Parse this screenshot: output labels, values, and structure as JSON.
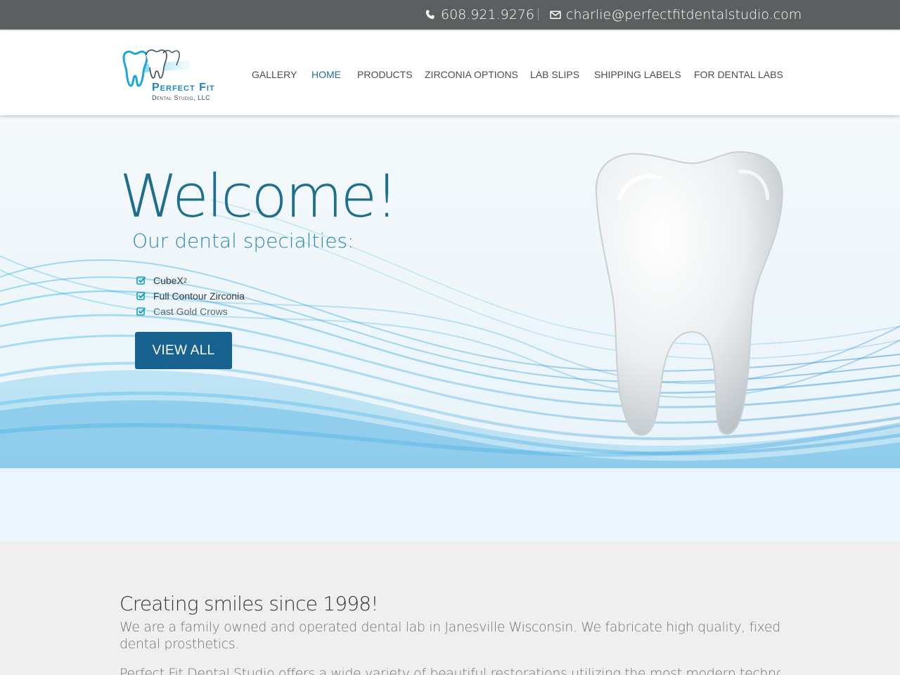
{
  "topbar": {
    "phone": "608.921.9276",
    "email": "charlie@perfectfitdentalstudio.com"
  },
  "logo": {
    "brand": "Perfect Fit",
    "sub": "Dental Studio, LLC"
  },
  "nav": {
    "items": [
      {
        "label": "GALLERY"
      },
      {
        "label": "HOME"
      },
      {
        "label": "PRODUCTS"
      },
      {
        "label": "ZIRCONIA OPTIONS"
      },
      {
        "label": "LAB SLIPS"
      },
      {
        "label": "SHIPPING LABELS"
      },
      {
        "label": "FOR DENTAL LABS"
      }
    ],
    "active": "HOME"
  },
  "hero": {
    "title": "Welcome!",
    "subtitle": "Our dental specialties:",
    "specialties": [
      {
        "label": "CubeX",
        "sup": "2"
      },
      {
        "label": "Full Contour Zirconia",
        "sup": ""
      },
      {
        "label": "Cast Gold Crows",
        "sup": ""
      }
    ],
    "button_label": "VIEW ALL"
  },
  "about": {
    "heading": "Creating smiles since 1998!",
    "paragraph1": "We are a family owned and operated dental lab in Janesville Wisconsin. We fabricate high quality, fixed dental prosthetics.",
    "paragraph2": "Perfect Fit Dental Studio offers a wide variety of beautiful restorations utilizing the most modern technology and"
  },
  "colors": {
    "topbar_bg": "#5b5f60",
    "accent": "#1e6f8e",
    "button_bg": "#17618f",
    "check": "#1a9fb8"
  },
  "icons": {
    "phone": "phone-icon",
    "email": "envelope-icon",
    "check": "check-square-icon"
  }
}
